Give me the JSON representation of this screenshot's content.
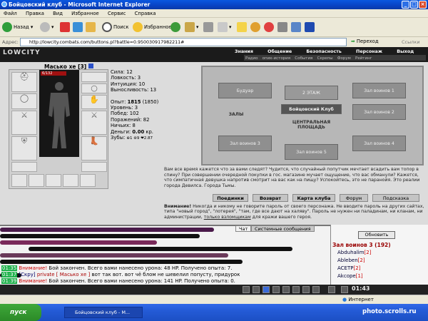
{
  "window": {
    "title": "Бойцовский клуб - Microsoft Internet Explorer"
  },
  "menu": [
    "Файл",
    "Правка",
    "Вид",
    "Избранное",
    "Сервис",
    "Справка"
  ],
  "toolbar": {
    "back": "Назад",
    "search": "Поиск",
    "favorites": "Избранное"
  },
  "address": {
    "label": "Адрес:",
    "url": "http://lowcity.combats.com/buttons.pl?battle=0.950030917982211#",
    "go": "Переход",
    "links": "Ссылки"
  },
  "game": {
    "logo": "LOWCITY",
    "tabs": [
      "Знания",
      "Общение",
      "Безопасность",
      "Персонаж",
      "Выход"
    ],
    "subtabs": [
      "Радио",
      "опик-история",
      "События",
      "Скрепы",
      "Форум",
      "Рейтинг"
    ]
  },
  "character": {
    "name": "Масько хе",
    "level": "[3]",
    "hp": "6/132",
    "stats": {
      "strength": "Сила: 12",
      "agility": "Ловкость: 3",
      "intuition": "Интуиция: 10",
      "endurance": "Выносливость: 13",
      "exp_label": "Опыт:",
      "exp_value": "1815",
      "exp_next": "(1850)",
      "level": "Уровень: 3",
      "wins": "Побед: 102",
      "losses": "Поражений: 82",
      "draws": "Ничьих: 8",
      "money_label": "Деньги:",
      "money_value": "0.00",
      "money_unit": "кр.",
      "teeth": "Зубы:",
      "teeth_values": "⊕1 ⊛9 ❤2.87"
    }
  },
  "map": {
    "rooms": [
      "Будуар",
      "Зал воинов 1",
      "2 ЭТАЖ",
      "Бойцовский Клуб",
      "ЗАЛЫ",
      "ЦЕНТРАЛЬНАЯ ПЛОЩАДЬ",
      "Зал воинов 2",
      "Зал воинов 3",
      "Зал воинов 4",
      "Зал воинов 5"
    ]
  },
  "notice": "Вам все время кажется что за вами следят? Чудится, что случайный попутчик мечтает всадить вам топор в спину? При совершении очередной покупки в гос. магазине мучает ощущение, что вас обманули? Кажется, что симпатичная девушка напротив смотрит на вас как на пищу? Успокойтесь, это не паранойя. Это реалии города Девилса. Города Тьмы.",
  "actions": {
    "fights": "Поединки",
    "return": "Возврат",
    "map": "Карта клуба",
    "forum": "Форум",
    "hint": "Подсказка"
  },
  "warning": {
    "label": "Внимание!",
    "text": "Никогда и никому не говорите пароль от своего персонажа. Не вводите пароль на других сайтах, типа \"новый город\", \"лотерея\", \"там, где все дают на халяву\". Пароль не нужен ни паладинам, ни кланам, ни администрации,",
    "link": "только взломщикам",
    "tail": "для кражи вашего героя."
  },
  "chat": {
    "tabs": [
      "Чат",
      "Системные сообщения"
    ],
    "lines": [
      {
        "time": "01:35",
        "label": "Внимание!",
        "text": "Бой закончен. Всего вами нанесено урона: 48 HP. Получено опыта: 7."
      },
      {
        "time": "01:37",
        "label": "[Скру]",
        "private": "private [ Масько хе ]",
        "text": "вот так вот. вот чё блом не шевелил попусту, придурок"
      },
      {
        "time": "01:39",
        "label": "Внимание!",
        "text": "Бой закончен. Всего вами нанесено урона: 141 HP. Получено опыта: 0."
      }
    ]
  },
  "online": {
    "refresh": "Обновить",
    "title": "Зал воинов 3 (192)",
    "users": [
      {
        "name": "Abduhalim",
        "level": "[2]"
      },
      {
        "name": "Ableben",
        "level": "[2]"
      },
      {
        "name": "ACETP",
        "level": "[2]"
      },
      {
        "name": "Akcope",
        "level": "[1]"
      }
    ]
  },
  "clock": "01:43",
  "status": {
    "zone": "Интернет"
  },
  "taskbar": {
    "start": "пуск",
    "item": "Бойцовский клуб - M...",
    "watermark": "photo.scrolls.ru"
  }
}
